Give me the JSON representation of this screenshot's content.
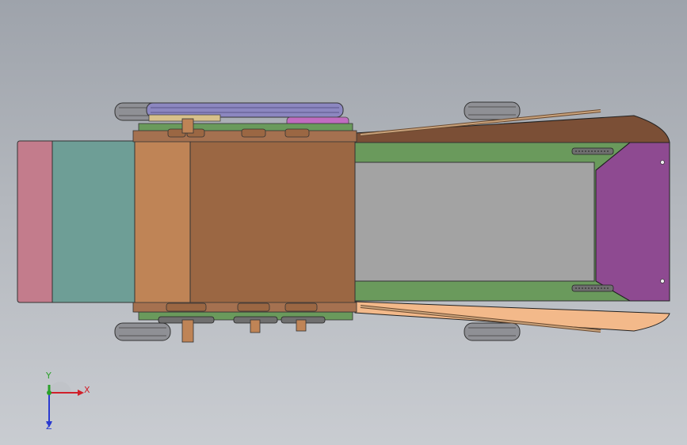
{
  "viewport": {
    "kind": "cad-3d-view"
  },
  "model": {
    "colors": {
      "hopper_pink": "#c37c8c",
      "hopper_teal": "#6e9e96",
      "roller_front": "#bf8456",
      "roller_main": "#9b6743",
      "frame_green": "#6a9a5c",
      "bed_gray": "#a3a3a3",
      "panel_purple": "#8e4a91",
      "hood_brown": "#7b4f36",
      "hood_peach": "#f3b98a",
      "belt_lavender": "#8c87c0",
      "wheel_gray": "#8f9095",
      "sprocket": "#5a5a5a"
    }
  },
  "triad": {
    "x_label": "X",
    "y_label": "Y",
    "z_label": "Z",
    "x_color": "#d0202a",
    "y_color": "#2aa02a",
    "z_color": "#2a3ad0"
  }
}
